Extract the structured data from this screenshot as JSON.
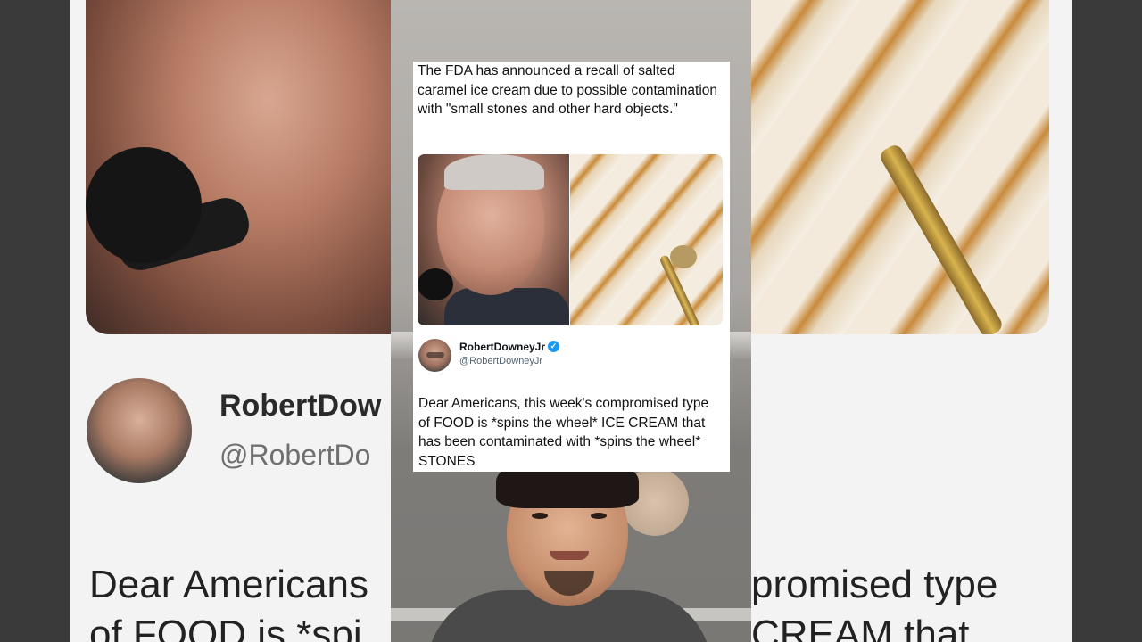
{
  "tweet": {
    "headline": "The FDA has announced a recall of salted caramel ice cream due to possible contamination with \"small stones and other hard objects.\"",
    "author_name": "RobertDowneyJr",
    "author_handle": "@RobertDowneyJr",
    "verified_symbol": "✓",
    "body": "Dear Americans, this week's compromised type of FOOD is *spins the wheel* ICE CREAM that has been contaminated with *spins the wheel* STONES"
  },
  "background": {
    "name_fragment": "RobertDow",
    "handle_fragment": "@RobertDo",
    "body_left_line1": "Dear Americans",
    "body_left_line2": "of FOOD is *spi",
    "body_right_line1": "promised type",
    "body_right_line2": "CREAM that"
  },
  "colors": {
    "verified_badge": "#1d9bf0",
    "handle_gray": "#536471",
    "card_bg": "#ffffff"
  },
  "icons": {
    "verified": "verified-badge-icon"
  }
}
